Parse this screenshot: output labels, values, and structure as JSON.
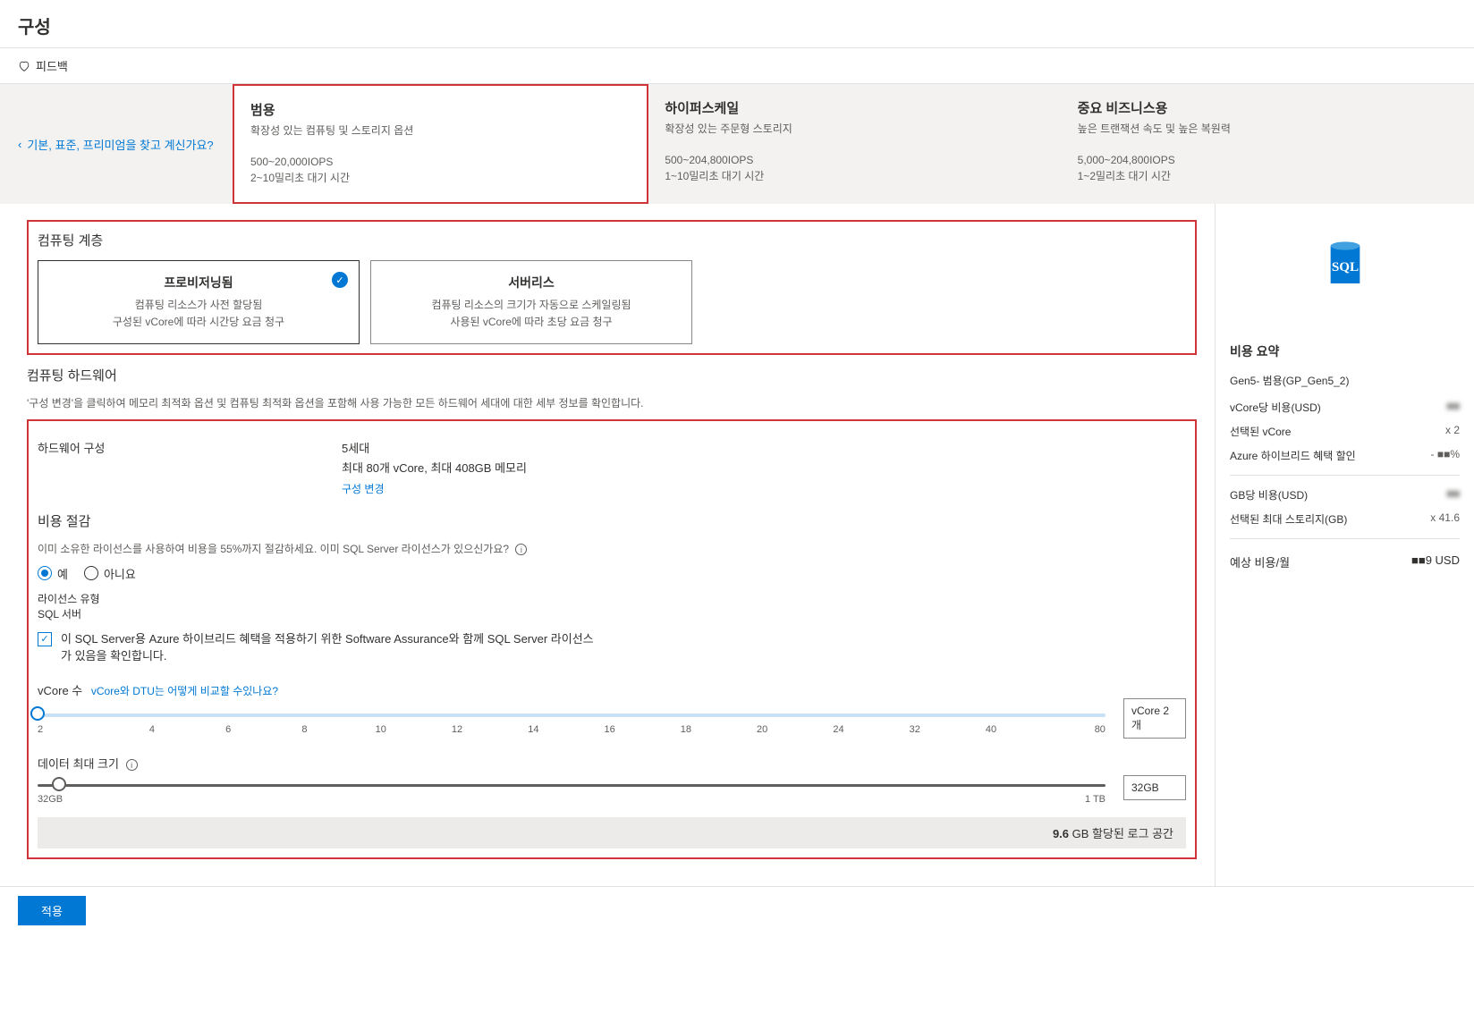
{
  "page_title": "구성",
  "feedback_label": "피드백",
  "legacy_tier_link": "기본, 표준, 프리미엄을 찾고 계신가요?",
  "tiers": [
    {
      "name": "범용",
      "desc": "확장성 있는 컴퓨팅 및 스토리지 옵션",
      "iops": "500~20,000IOPS",
      "latency": "2~10밀리초 대기 시간",
      "selected": true
    },
    {
      "name": "하이퍼스케일",
      "desc": "확장성 있는 주문형 스토리지",
      "iops": "500~204,800IOPS",
      "latency": "1~10밀리초 대기 시간",
      "selected": false
    },
    {
      "name": "중요 비즈니스용",
      "desc": "높은 트랜잭션 속도 및 높은 복원력",
      "iops": "5,000~204,800IOPS",
      "latency": "1~2밀리초 대기 시간",
      "selected": false
    }
  ],
  "compute_tier": {
    "heading": "컴퓨팅 계층",
    "cards": [
      {
        "title": "프로비저닝됨",
        "line1": "컴퓨팅 리소스가 사전 할당됨",
        "line2": "구성된 vCore에 따라 시간당 요금 청구",
        "selected": true
      },
      {
        "title": "서버리스",
        "line1": "컴퓨팅 리소스의 크기가 자동으로 스케일링됨",
        "line2": "사용된 vCore에 따라 초당 요금 청구",
        "selected": false
      }
    ]
  },
  "compute_hw": {
    "heading": "컴퓨팅 하드웨어",
    "desc": "'구성 변경'을 클릭하여 메모리 최적화 옵션 및 컴퓨팅 최적화 옵션을 포함해 사용 가능한 모든 하드웨어 세대에 대한 세부 정보를 확인합니다.",
    "hw_config_label": "하드웨어 구성",
    "hw_gen": "5세대",
    "hw_spec": "최대 80개 vCore, 최대 408GB 메모리",
    "change_link": "구성 변경"
  },
  "cost_savings": {
    "heading": "비용 절감",
    "desc": "이미 소유한 라이선스를 사용하여 비용을 55%까지 절감하세요. 이미 SQL Server 라이선스가 있으신가요?",
    "yes": "예",
    "no": "아니요",
    "license_type_label": "라이선스 유형",
    "license_type_value": "SQL 서버",
    "hybrid_check": "이 SQL Server용 Azure 하이브리드 혜택을 적용하기 위한 Software Assurance와 함께 SQL Server 라이선스가 있음을 확인합니다."
  },
  "vcores": {
    "label": "vCore 수",
    "help": "vCore와 DTU는 어떻게 비교할 수있나요?",
    "value_display": "vCore 2개",
    "ticks": [
      "2",
      "4",
      "6",
      "8",
      "10",
      "12",
      "14",
      "16",
      "18",
      "20",
      "24",
      "32",
      "40",
      "80"
    ]
  },
  "data_size": {
    "label": "데이터 최대 크기",
    "min": "32GB",
    "max": "1 TB",
    "value": "32GB"
  },
  "log_space": {
    "value": "9.6",
    "suffix": "GB 할당된 로그 공간"
  },
  "cost_summary": {
    "heading": "비용 요약",
    "sku": "Gen5- 범용(GP_Gen5_2)",
    "per_vcore_label": "vCore당 비용(USD)",
    "selected_vcore_label": "선택된 vCore",
    "selected_vcore_value": "x 2",
    "hybrid_label": "Azure 하이브리드 혜택 할인",
    "hybrid_value": "- ■■%",
    "per_gb_label": "GB당 비용(USD)",
    "selected_storage_label": "선택된 최대 스토리지(GB)",
    "selected_storage_value": "x 41.6",
    "est_label": "예상 비용/월",
    "est_value": "■■9 USD"
  },
  "apply_label": "적용"
}
